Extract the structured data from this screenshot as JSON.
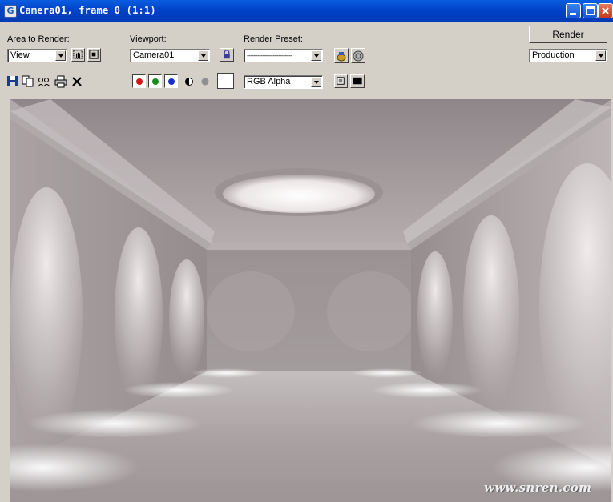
{
  "window": {
    "title": "Camera01, frame 0 (1:1)"
  },
  "area": {
    "label": "Area to Render:",
    "value": "View"
  },
  "viewport": {
    "label": "Viewport:",
    "value": "Camera01"
  },
  "preset": {
    "label": "Render Preset:",
    "value": "--------------------------"
  },
  "render": {
    "button_label": "Render",
    "mode_value": "Production"
  },
  "channel": {
    "value": "RGB Alpha"
  },
  "channels": {
    "red": "#d01818",
    "green": "#1a8a1a",
    "blue": "#1830c8"
  },
  "watermark": "www.snren.com"
}
